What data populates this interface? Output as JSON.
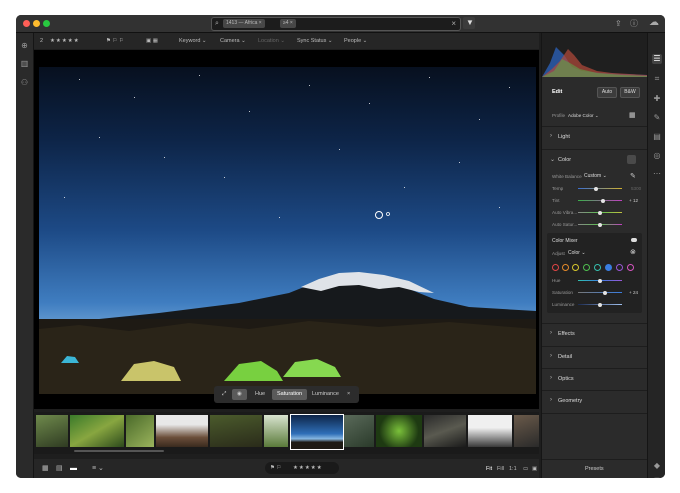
{
  "search": {
    "chip1": "1413 — Africa",
    "chip2": "≥4"
  },
  "topbar": {
    "count": "2",
    "stars": "★★★★★",
    "keyword": "Keyword",
    "camera": "Camera",
    "location": "Location",
    "sync_status": "Sync Status",
    "people": "People"
  },
  "mask": {
    "hue": "Hue",
    "saturation": "Saturation",
    "luminance": "Luminance"
  },
  "bottombar": {
    "stars": "★★★★★",
    "fit": "Fit",
    "fill": "Fill",
    "one_to_one": "1:1"
  },
  "panel": {
    "edit_title": "Edit",
    "auto_label": "Auto",
    "bw_label": "B&W",
    "profile_label": "Profile",
    "profile_value": "Adobe Color",
    "light": "Light",
    "color": "Color",
    "white_balance_label": "White Balance",
    "white_balance_value": "Custom",
    "temp": "Temp",
    "tint": "Tint",
    "tint_value": "+ 12",
    "vibrance": "Auto Vibra...",
    "saturation": "Auto Satur...",
    "color_mixer": "Color Mixer",
    "adjust_label": "Adjust",
    "adjust_value": "Color",
    "mix_hue": "Hue",
    "mix_saturation": "Saturation",
    "mix_saturation_value": "+ 24",
    "mix_luminance": "Luminance",
    "effects": "Effects",
    "detail": "Detail",
    "optics": "Optics",
    "geometry": "Geometry",
    "presets": "Presets"
  },
  "colors": {
    "mixer_swatches": [
      "#e04545",
      "#e58a2a",
      "#d8c72c",
      "#4fbf4f",
      "#35c0b0",
      "#3a7de0",
      "#9a57d6",
      "#d655c0"
    ]
  }
}
